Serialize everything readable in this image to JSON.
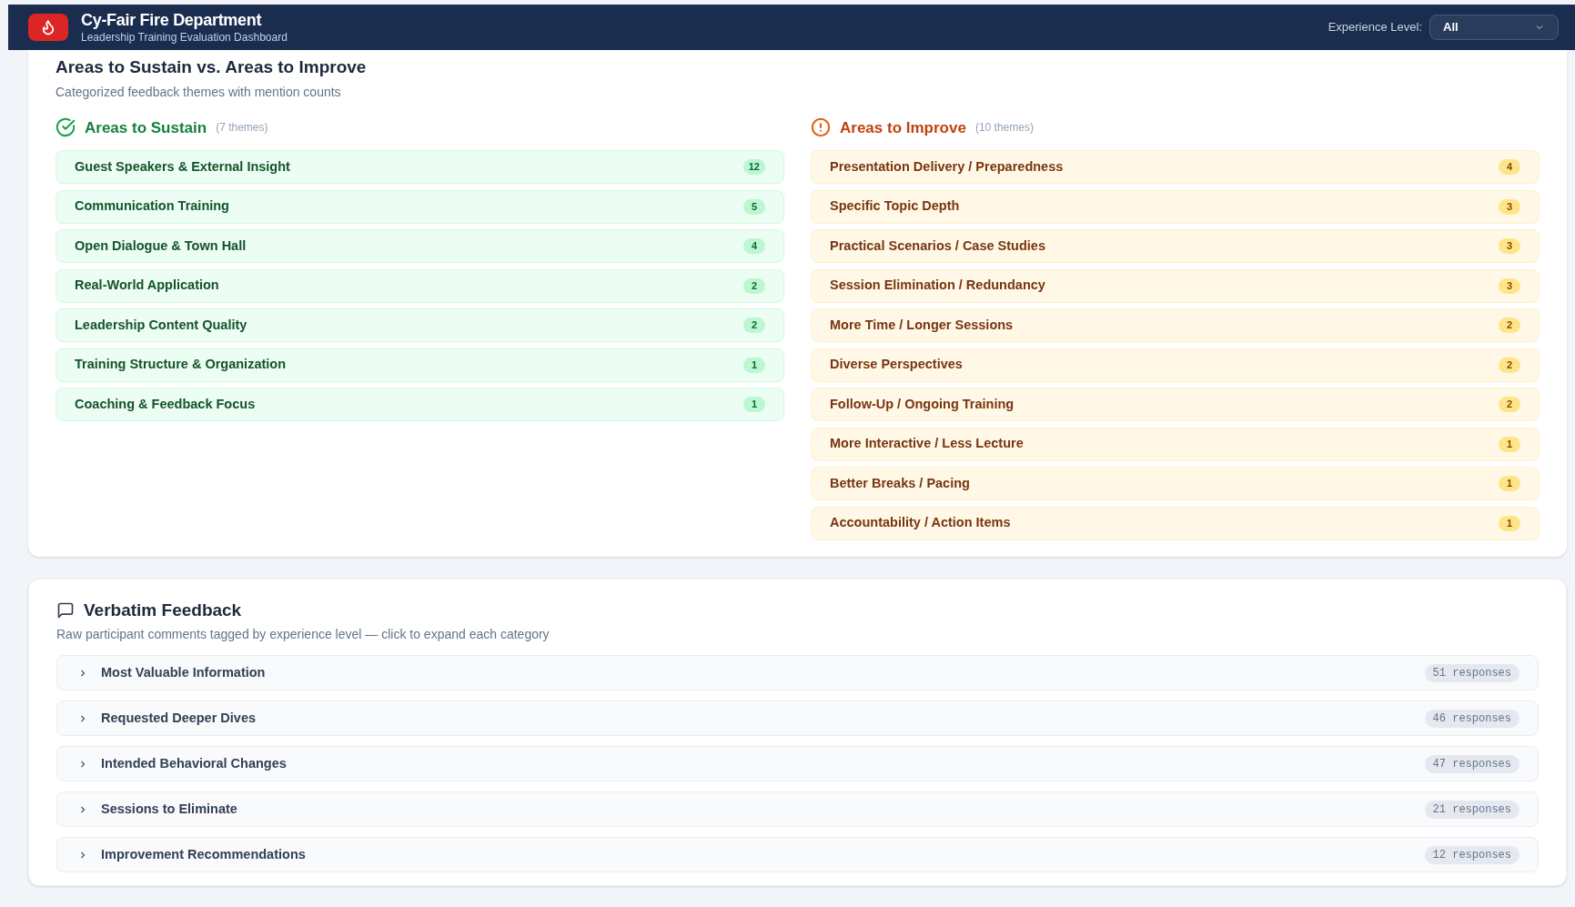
{
  "header": {
    "title": "Cy-Fair Fire Department",
    "subtitle": "Leadership Training Evaluation Dashboard",
    "filter": {
      "label": "Experience Level:",
      "value": "All"
    }
  },
  "themes_card": {
    "title": "Areas to Sustain vs. Areas to Improve",
    "subtitle": "Categorized feedback themes with mention counts",
    "groups": [
      {
        "kind": "sustain",
        "title": "Areas to Sustain",
        "count_label": "(7 themes)",
        "items": [
          {
            "label": "Guest Speakers & External Insight",
            "count": "12"
          },
          {
            "label": "Communication Training",
            "count": "5"
          },
          {
            "label": "Open Dialogue & Town Hall",
            "count": "4"
          },
          {
            "label": "Real-World Application",
            "count": "2"
          },
          {
            "label": "Leadership Content Quality",
            "count": "2"
          },
          {
            "label": "Training Structure & Organization",
            "count": "1"
          },
          {
            "label": "Coaching & Feedback Focus",
            "count": "1"
          }
        ]
      },
      {
        "kind": "improve",
        "title": "Areas to Improve",
        "count_label": "(10 themes)",
        "items": [
          {
            "label": "Presentation Delivery / Preparedness",
            "count": "4"
          },
          {
            "label": "Specific Topic Depth",
            "count": "3"
          },
          {
            "label": "Practical Scenarios / Case Studies",
            "count": "3"
          },
          {
            "label": "Session Elimination / Redundancy",
            "count": "3"
          },
          {
            "label": "More Time / Longer Sessions",
            "count": "2"
          },
          {
            "label": "Diverse Perspectives",
            "count": "2"
          },
          {
            "label": "Follow-Up / Ongoing Training",
            "count": "2"
          },
          {
            "label": "More Interactive / Less Lecture",
            "count": "1"
          },
          {
            "label": "Better Breaks / Pacing",
            "count": "1"
          },
          {
            "label": "Accountability / Action Items",
            "count": "1"
          }
        ]
      }
    ]
  },
  "verbatim": {
    "title": "Verbatim Feedback",
    "subtitle": "Raw participant comments tagged by experience level — click to expand each category",
    "categories": [
      {
        "label": "Most Valuable Information",
        "responses": "51 responses",
        "expanded": false
      },
      {
        "label": "Requested Deeper Dives",
        "responses": "46 responses",
        "expanded": false
      },
      {
        "label": "Intended Behavioral Changes",
        "responses": "47 responses",
        "expanded": false
      },
      {
        "label": "Sessions to Eliminate",
        "responses": "21 responses",
        "expanded": false
      },
      {
        "label": "Improvement Recommendations",
        "responses": "12 responses",
        "expanded": false
      }
    ]
  }
}
